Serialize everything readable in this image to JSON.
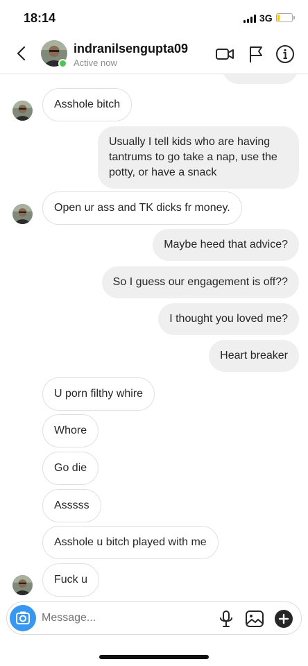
{
  "status_bar": {
    "time": "18:14",
    "network": "3G",
    "battery_level": 0.15,
    "battery_color": "#f5c400"
  },
  "header": {
    "username": "indranilsengupta09",
    "status": "Active now",
    "icons": [
      "back-icon",
      "video-call-icon",
      "flag-icon",
      "info-icon"
    ],
    "online_color": "#4cc552"
  },
  "messages": [
    {
      "side": "incoming",
      "text": "Asshole bitch"
    },
    {
      "side": "outgoing",
      "text": "Usually I tell kids who are having tantrums to go take a nap, use the potty, or have a snack"
    },
    {
      "side": "incoming",
      "text": "Open ur ass and TK dicks fr money."
    },
    {
      "side": "outgoing",
      "text": "Maybe heed that advice?"
    },
    {
      "side": "outgoing",
      "text": "So I guess our engagement is off??"
    },
    {
      "side": "outgoing",
      "text": "I thought you loved me?"
    },
    {
      "side": "outgoing",
      "text": "Heart breaker"
    },
    {
      "side": "incoming",
      "text": "U porn filthy whire"
    },
    {
      "side": "incoming",
      "text": "Whore"
    },
    {
      "side": "incoming",
      "text": "Go die"
    },
    {
      "side": "incoming",
      "text": "Asssss"
    },
    {
      "side": "incoming",
      "text": "Asshole u bitch played with me"
    },
    {
      "side": "incoming",
      "text": "Fuck u"
    }
  ],
  "composer": {
    "placeholder": "Message...",
    "icons": [
      "camera-icon",
      "microphone-icon",
      "gallery-icon",
      "add-icon"
    ],
    "camera_color": "#3897f0"
  },
  "colors": {
    "outgoing_bubble": "#efefef",
    "incoming_border": "#e0e0e0"
  }
}
